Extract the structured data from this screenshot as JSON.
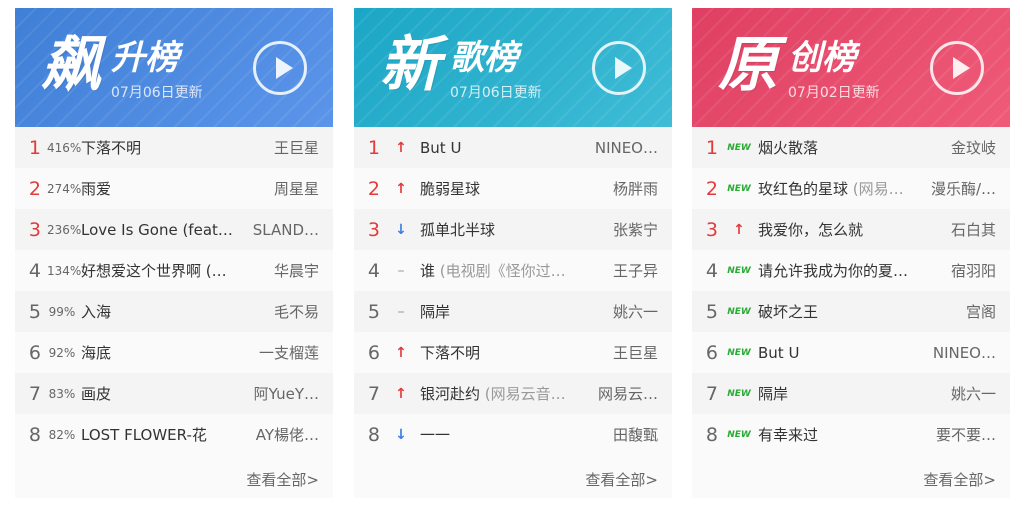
{
  "boards": [
    {
      "id": "rise",
      "big": "飙",
      "small": "升榜",
      "date": "07月06日更新",
      "gradient": [
        "#3f7fd6",
        "#5b95ea"
      ],
      "view_all": "查看全部>",
      "rows": [
        {
          "rank": "1",
          "tag": "416%",
          "tag_type": "pct",
          "title": "下落不明",
          "alias": "",
          "artist": "王巨星"
        },
        {
          "rank": "2",
          "tag": "274%",
          "tag_type": "pct",
          "title": "雨爱",
          "alias": "",
          "artist": "周星星"
        },
        {
          "rank": "3",
          "tag": "236%",
          "tag_type": "pct",
          "title": "Love Is Gone (feat…",
          "alias": "",
          "artist": "SLAND…"
        },
        {
          "rank": "4",
          "tag": "134%",
          "tag_type": "pct",
          "title": "好想爱这个世界啊 (…",
          "alias": "",
          "artist": "华晨宇"
        },
        {
          "rank": "5",
          "tag": "99%",
          "tag_type": "pct",
          "title": "入海",
          "alias": "",
          "artist": "毛不易"
        },
        {
          "rank": "6",
          "tag": "92%",
          "tag_type": "pct",
          "title": "海底",
          "alias": "",
          "artist": "一支榴莲"
        },
        {
          "rank": "7",
          "tag": "83%",
          "tag_type": "pct",
          "title": "画皮",
          "alias": "",
          "artist": "阿YueY…"
        },
        {
          "rank": "8",
          "tag": "82%",
          "tag_type": "pct",
          "title": "LOST FLOWER-花",
          "alias": "",
          "artist": "AY楊佬…"
        }
      ]
    },
    {
      "id": "new",
      "big": "新",
      "small": "歌榜",
      "date": "07月06日更新",
      "gradient": [
        "#1ba6c5",
        "#3fbcd6"
      ],
      "view_all": "查看全部>",
      "rows": [
        {
          "rank": "1",
          "tag": "↑",
          "tag_type": "up",
          "title": "But U",
          "alias": "",
          "artist": "NINEO…"
        },
        {
          "rank": "2",
          "tag": "↑",
          "tag_type": "up",
          "title": "脆弱星球",
          "alias": "",
          "artist": "杨胖雨"
        },
        {
          "rank": "3",
          "tag": "↓",
          "tag_type": "down",
          "title": "孤单北半球",
          "alias": "",
          "artist": "张紫宁"
        },
        {
          "rank": "4",
          "tag": "–",
          "tag_type": "same",
          "title": "谁",
          "alias": " (电视剧《怪你过…",
          "artist": "王子异"
        },
        {
          "rank": "5",
          "tag": "–",
          "tag_type": "same",
          "title": "隔岸",
          "alias": "",
          "artist": "姚六一"
        },
        {
          "rank": "6",
          "tag": "↑",
          "tag_type": "up",
          "title": "下落不明",
          "alias": "",
          "artist": "王巨星"
        },
        {
          "rank": "7",
          "tag": "↑",
          "tag_type": "up",
          "title": "银河赴约",
          "alias": " (网易云音…",
          "artist": "网易云…"
        },
        {
          "rank": "8",
          "tag": "↓",
          "tag_type": "down",
          "title": "一一",
          "alias": "",
          "artist": "田馥甄"
        }
      ]
    },
    {
      "id": "original",
      "big": "原",
      "small": "创榜",
      "date": "07月02日更新",
      "gradient": [
        "#df3f62",
        "#ef5b78"
      ],
      "view_all": "查看全部>",
      "rows": [
        {
          "rank": "1",
          "tag": "NEW",
          "tag_type": "new",
          "title": "烟火散落",
          "alias": "",
          "artist": "金玟岐"
        },
        {
          "rank": "2",
          "tag": "NEW",
          "tag_type": "new",
          "title": "玫红色的星球",
          "alias": " (网易…",
          "artist": "漫乐酶/…"
        },
        {
          "rank": "3",
          "tag": "↑",
          "tag_type": "up",
          "title": "我爱你，怎么就",
          "alias": "",
          "artist": "石白其"
        },
        {
          "rank": "4",
          "tag": "NEW",
          "tag_type": "new",
          "title": "请允许我成为你的夏…",
          "alias": "",
          "artist": "宿羽阳"
        },
        {
          "rank": "5",
          "tag": "NEW",
          "tag_type": "new",
          "title": "破坏之王",
          "alias": "",
          "artist": "宫阁"
        },
        {
          "rank": "6",
          "tag": "NEW",
          "tag_type": "new",
          "title": "But U",
          "alias": "",
          "artist": "NINEO…"
        },
        {
          "rank": "7",
          "tag": "NEW",
          "tag_type": "new",
          "title": "隔岸",
          "alias": "",
          "artist": "姚六一"
        },
        {
          "rank": "8",
          "tag": "NEW",
          "tag_type": "new",
          "title": "有幸来过",
          "alias": "",
          "artist": "要不要…"
        }
      ]
    }
  ]
}
